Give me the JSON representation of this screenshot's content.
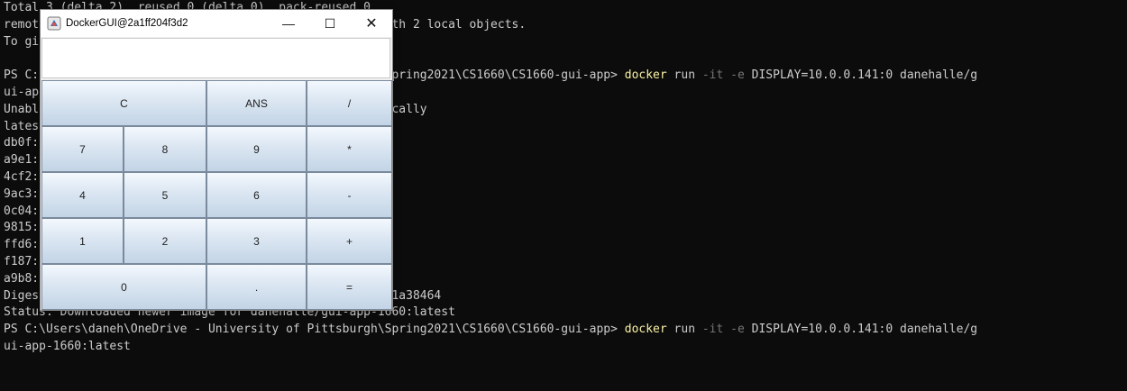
{
  "terminal": {
    "lines": [
      {
        "text": "Total 3 (delta 2), reused 0 (delta 0), pack-reused 0"
      },
      {
        "text": "remote: Counting objects: 100% (2/2), done. Unpacked with 2 local objects."
      },
      {
        "text": "To github.com:danehalle/CS1660-gui-app.git"
      },
      {
        "text": ""
      },
      {
        "segments": [
          {
            "t": "PS C:\\Users\\daneh\\OneDrive - University of Pittsburgh\\Spring2021\\CS1660\\CS1660-gui-app> ",
            "c": ""
          },
          {
            "t": "docker",
            "c": "kw"
          },
          {
            "t": " run ",
            "c": ""
          },
          {
            "t": "-it -e",
            "c": "flag"
          },
          {
            "t": " DISPLAY=10.0.0.141:0 danehalle/g",
            "c": ""
          }
        ]
      },
      {
        "text": "ui-app-1660:latest"
      },
      {
        "text": "Unable to find image 'danehalle/gui-app-1660:latest' locally"
      },
      {
        "text": "latest: Pulling from danehalle/gui-app-1660"
      },
      {
        "text": "db0f: Pull complete"
      },
      {
        "text": "a9e1: Pull complete"
      },
      {
        "text": "4cf2: Pull complete"
      },
      {
        "text": "9ac3: Pull complete"
      },
      {
        "text": "0c04: Pull complete"
      },
      {
        "text": "9815: Pull complete"
      },
      {
        "text": "ffd6: Pull complete"
      },
      {
        "text": "f187: Pull complete"
      },
      {
        "text": "a9b8: Pull complete"
      },
      {
        "text": "Digest: sha256:7e0d4c1b2a9f3e8d5c16dc6cb94661fdb5c510351a38464"
      },
      {
        "text": "Status: Downloaded newer image for danehalle/gui-app-1660:latest"
      },
      {
        "segments": [
          {
            "t": "PS C:\\Users\\daneh\\OneDrive - University of Pittsburgh\\Spring2021\\CS1660\\CS1660-gui-app> ",
            "c": ""
          },
          {
            "t": "docker",
            "c": "kw"
          },
          {
            "t": " run ",
            "c": ""
          },
          {
            "t": "-it -e",
            "c": "flag"
          },
          {
            "t": " DISPLAY=10.0.0.141:0 danehalle/g",
            "c": ""
          }
        ]
      },
      {
        "text": "ui-app-1660:latest"
      }
    ]
  },
  "calculator": {
    "title": "DockerGUI@2a1ff204f3d2",
    "window_controls": {
      "minimize": "—",
      "maximize": "☐",
      "close": "✕"
    },
    "display_value": "",
    "keys": [
      {
        "label": "C",
        "id": "clear"
      },
      {
        "label": "ANS",
        "id": "ans"
      },
      {
        "label": "/",
        "id": "divide"
      },
      {
        "label": "7",
        "id": "7"
      },
      {
        "label": "8",
        "id": "8"
      },
      {
        "label": "9",
        "id": "9"
      },
      {
        "label": "*",
        "id": "multiply"
      },
      {
        "label": "4",
        "id": "4"
      },
      {
        "label": "5",
        "id": "5"
      },
      {
        "label": "6",
        "id": "6"
      },
      {
        "label": "-",
        "id": "subtract"
      },
      {
        "label": "1",
        "id": "1"
      },
      {
        "label": "2",
        "id": "2"
      },
      {
        "label": "3",
        "id": "3"
      },
      {
        "label": "+",
        "id": "add"
      },
      {
        "label": "0",
        "id": "0"
      },
      {
        "label": ".",
        "id": "decimal"
      },
      {
        "label": "=",
        "id": "equals"
      }
    ]
  }
}
